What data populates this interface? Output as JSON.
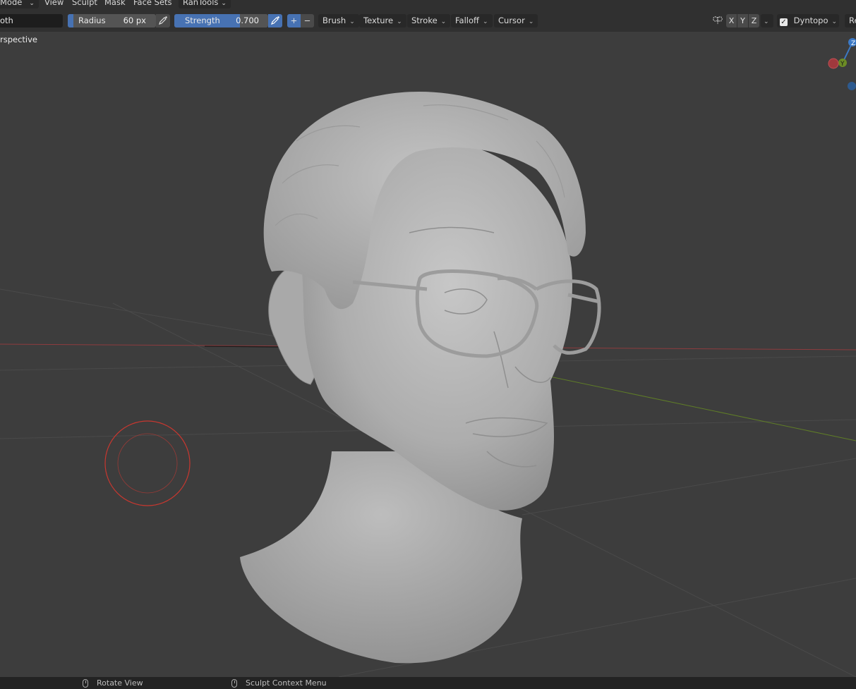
{
  "menubar": {
    "mode_label": "Mode",
    "menus": [
      "View",
      "Sculpt",
      "Mask",
      "Face Sets"
    ],
    "addon_label": "RanTools"
  },
  "toolbar": {
    "brush_name": "oth",
    "radius": {
      "label": "Radius",
      "value": "60 px",
      "fill_fraction": 0.06
    },
    "strength": {
      "label": "Strength",
      "value": "0.700",
      "fill_fraction": 0.7
    },
    "direction_add": "+",
    "direction_subtract": "−",
    "menus": [
      "Brush",
      "Texture",
      "Stroke",
      "Falloff",
      "Cursor"
    ],
    "symmetry_axes": [
      "X",
      "Y",
      "Z"
    ],
    "dyntopo_label": "Dyntopo",
    "dyntopo_checked": true,
    "cut_label": "Re"
  },
  "viewport": {
    "title": "rspective",
    "background_color": "#3d3d3d",
    "gizmo": {
      "z_label": "Z",
      "y_label": "Y"
    },
    "axis_colors": {
      "x": "#a0393d",
      "y": "#6c8c25",
      "z": "#3b79c6"
    },
    "brush_cursor_color": "#c8372f"
  },
  "statusbar": {
    "items": [
      {
        "icon": "mouse-icon",
        "label": "Rotate View"
      },
      {
        "icon": "mouse-icon",
        "label": "Sculpt Context Menu"
      }
    ]
  }
}
